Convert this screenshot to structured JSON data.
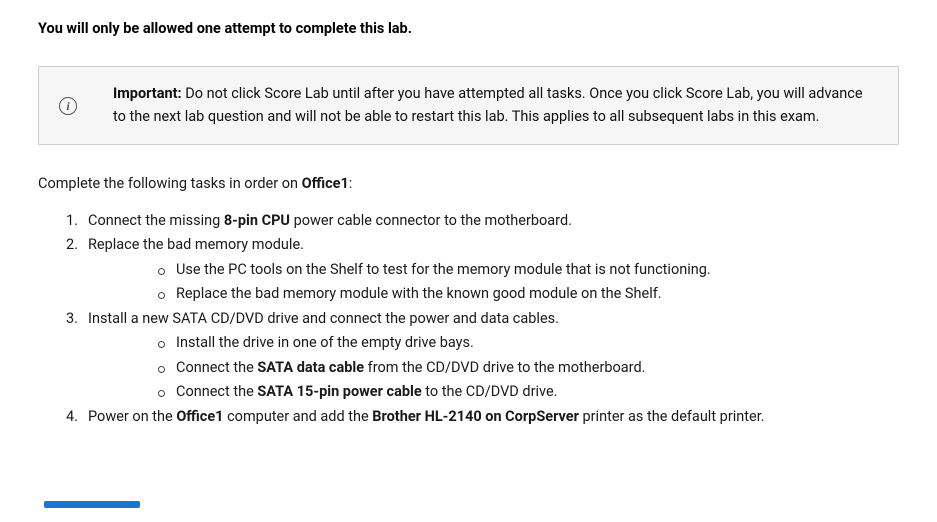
{
  "heading": "You will only be allowed one attempt to complete this lab.",
  "info": {
    "icon_label": "i",
    "bold_lead": "Important:",
    "text_rest": " Do not click Score Lab until after you have attempted all tasks. Once you click Score Lab, you will advance to the next lab question and will not be able to restart this lab. This applies to all subsequent labs in this exam."
  },
  "intro": {
    "pre": "Complete the following tasks in order on ",
    "bold": "Office1",
    "post": ":"
  },
  "tasks": {
    "t1": {
      "pre": "Connect the missing ",
      "b1": "8-pin CPU",
      "post": " power cable connector to the motherboard."
    },
    "t2": {
      "text": "Replace the bad memory module.",
      "sub1": "Use the PC tools on the Shelf to test for the memory module that is not functioning.",
      "sub2": "Replace the bad memory module with the known good module on the Shelf."
    },
    "t3": {
      "text": "Install a new SATA CD/DVD drive and connect the power and data cables.",
      "sub1": "Install the drive in one of the empty drive bays.",
      "sub2": {
        "pre": "Connect the ",
        "b": "SATA data cable",
        "post": " from the CD/DVD drive to the motherboard."
      },
      "sub3": {
        "pre": "Connect the ",
        "b": "SATA 15-pin power cable",
        "post": " to the CD/DVD drive."
      }
    },
    "t4": {
      "pre": "Power on the ",
      "b1": "Office1",
      "mid": " computer and add the ",
      "b2": "Brother HL-2140 on CorpServer",
      "post": " printer as the default printer."
    }
  }
}
